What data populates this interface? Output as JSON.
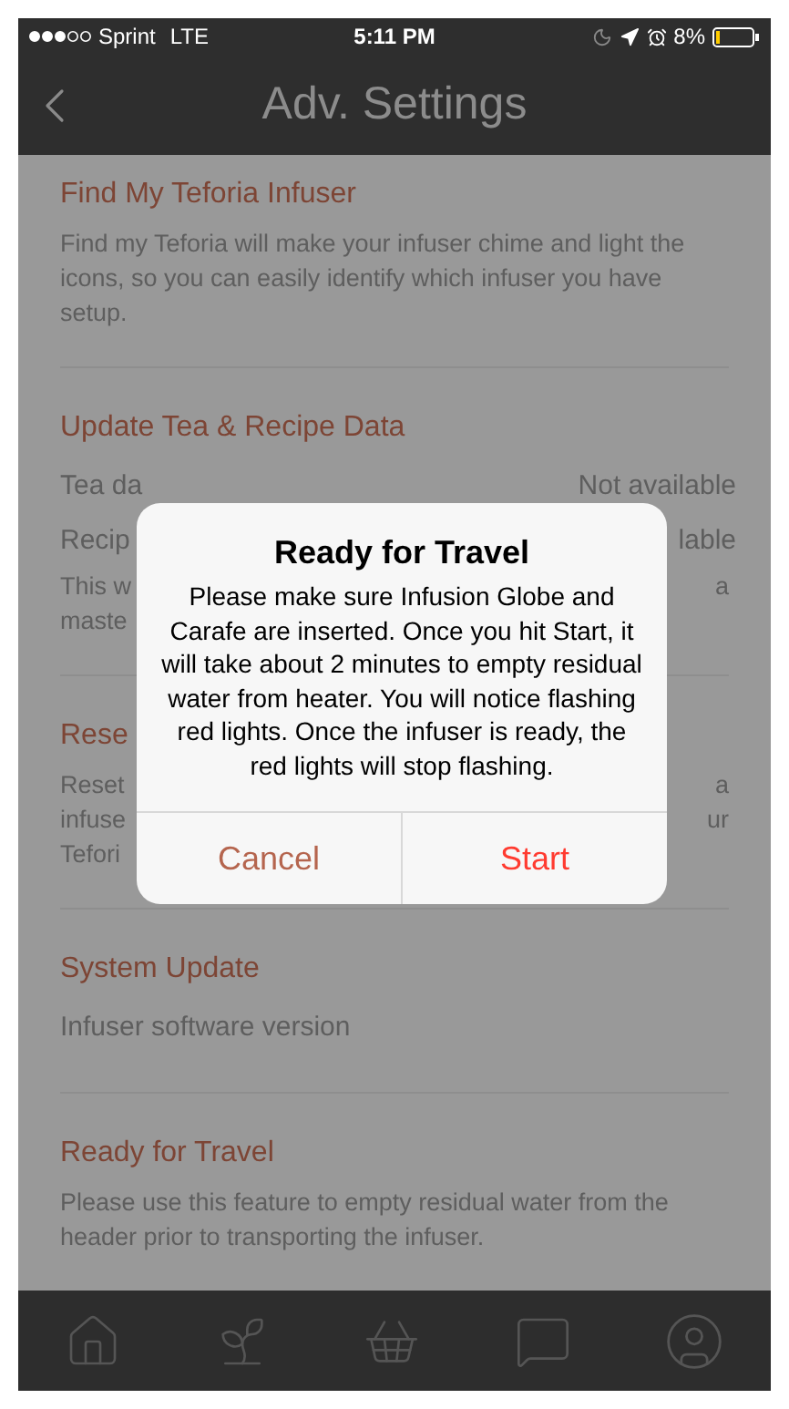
{
  "status_bar": {
    "carrier": "Sprint",
    "network": "LTE",
    "time": "5:11 PM",
    "battery": "8%"
  },
  "nav": {
    "title": "Adv. Settings"
  },
  "sections": [
    {
      "heading": "Find My Teforia Infuser",
      "items": [
        {
          "kind": "paragraph",
          "text": "Find my Teforia will make your infuser chime and light the icons, so you can easily identify which infuser you have setup."
        }
      ]
    },
    {
      "heading": "Update Tea & Recipe Data",
      "items": [
        {
          "kind": "row",
          "left": "Tea da",
          "right": "Not available"
        },
        {
          "kind": "row",
          "left": "Recip",
          "right": "lable"
        },
        {
          "kind": "line",
          "left": "This w",
          "right": "a"
        },
        {
          "kind": "line",
          "left": "maste"
        }
      ]
    },
    {
      "heading": "Rese",
      "items": [
        {
          "kind": "line",
          "left": "Reset",
          "right": "a"
        },
        {
          "kind": "line",
          "left": "infuse",
          "right": "ur"
        },
        {
          "kind": "line",
          "left": "Tefori"
        }
      ]
    },
    {
      "heading": "System Update",
      "items": [
        {
          "kind": "row",
          "left": "Infuser software version"
        }
      ]
    },
    {
      "heading": "Ready for Travel",
      "items": [
        {
          "kind": "paragraph",
          "text": "Please use this feature to empty residual water from the header prior to transporting the infuser."
        }
      ]
    }
  ],
  "dialog": {
    "title": "Ready for Travel",
    "message": "Please make sure Infusion Globe and Carafe are inserted. Once you hit Start, it will take about 2 minutes to empty residual water from heater. You will notice flashing red lights. Once the infuser is ready, the red lights will stop flashing.",
    "buttons": [
      {
        "label": "Cancel",
        "kind": "cancel"
      },
      {
        "label": "Start",
        "kind": "default"
      }
    ]
  }
}
